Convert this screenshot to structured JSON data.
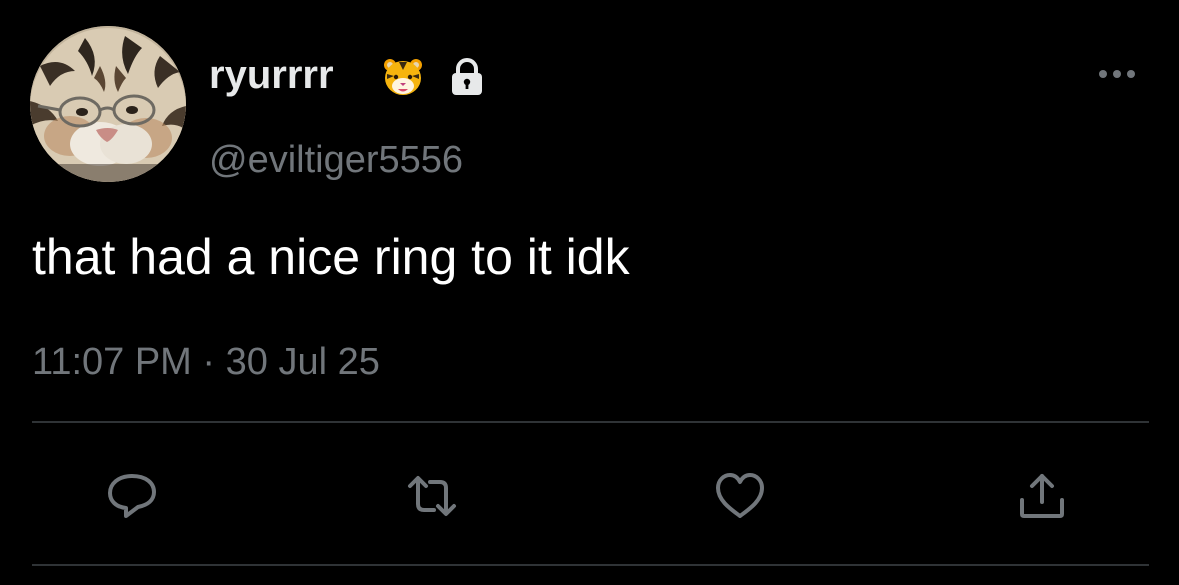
{
  "tweet": {
    "display_name": "ryurrrr",
    "handle": "@eviltiger5556",
    "text": "that had a nice ring to it idk",
    "time": "11:07 PM",
    "separator": "·",
    "date": "30 Jul 25"
  },
  "icons": {
    "name_emoji": "tiger-face-emoji",
    "protected": "lock-icon",
    "more": "more-options-icon",
    "actions": [
      "reply-icon",
      "retweet-icon",
      "like-icon",
      "share-icon"
    ]
  },
  "colors": {
    "background": "#000000",
    "primary_text": "#e7e9ea",
    "secondary_text": "#71767b",
    "divider": "#2f3336"
  }
}
